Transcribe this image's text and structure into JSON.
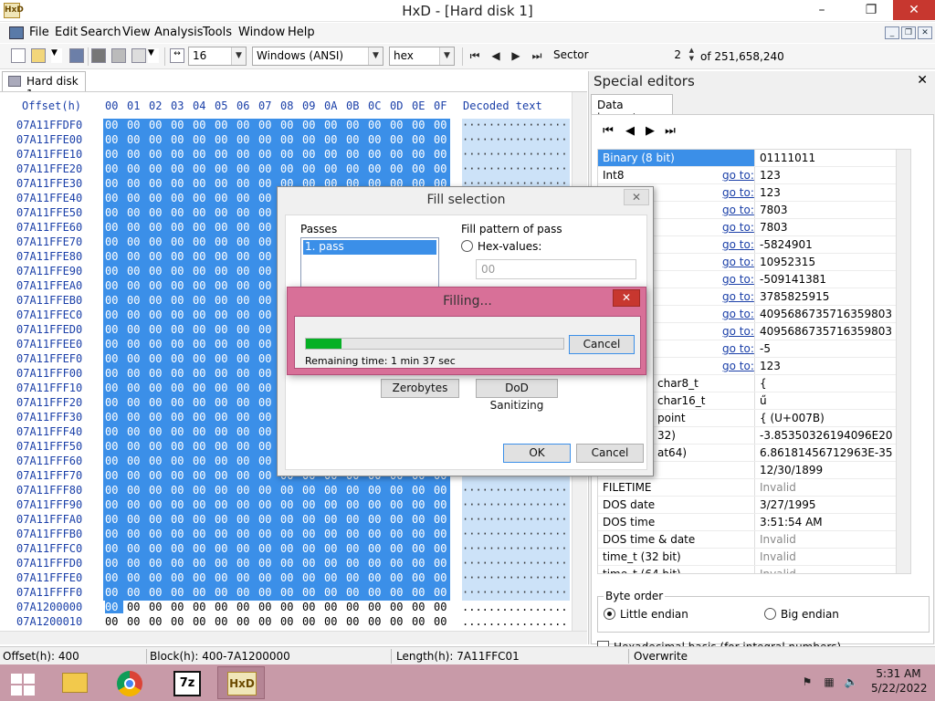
{
  "window": {
    "app_icon_text": "HxD",
    "title": "HxD - [Hard disk 1]",
    "minimize": "–",
    "restore": "❐",
    "close": "✕"
  },
  "menu": {
    "items": [
      "File",
      "Edit",
      "Search",
      "View",
      "Analysis",
      "Tools",
      "Window",
      "Help"
    ],
    "mdi_minimize": "_",
    "mdi_restore": "❐",
    "mdi_close": "✕"
  },
  "toolbar": {
    "bytes_per_row": "16",
    "charset": "Windows (ANSI)",
    "display_mode": "hex",
    "sector_label": "Sector",
    "sector_value": "2",
    "sector_total": "of 251,658,240",
    "icons": [
      "new-file-icon",
      "open-file-icon",
      "save-icon",
      "ram-editor-icon",
      "disk-icon",
      "print-icon",
      "columns-icon"
    ]
  },
  "document_tab": {
    "label": "Hard disk 1"
  },
  "hex_view": {
    "offset_header": "Offset(h)",
    "column_headers": [
      "00",
      "01",
      "02",
      "03",
      "04",
      "05",
      "06",
      "07",
      "08",
      "09",
      "0A",
      "0B",
      "0C",
      "0D",
      "0E",
      "0F"
    ],
    "decoded_header": "Decoded text",
    "byte": "00",
    "selected_dots": "················",
    "plain_dots": "................",
    "rows": [
      "07A11FFDF0",
      "07A11FFE00",
      "07A11FFE10",
      "07A11FFE20",
      "07A11FFE30",
      "07A11FFE40",
      "07A11FFE50",
      "07A11FFE60",
      "07A11FFE70",
      "07A11FFE80",
      "07A11FFE90",
      "07A11FFEA0",
      "07A11FFEB0",
      "07A11FFEC0",
      "07A11FFED0",
      "07A11FFEE0",
      "07A11FFEF0",
      "07A11FFF00",
      "07A11FFF10",
      "07A11FFF20",
      "07A11FFF30",
      "07A11FFF40",
      "07A11FFF50",
      "07A11FFF60",
      "07A11FFF70",
      "07A11FFF80",
      "07A11FFF90",
      "07A11FFFA0",
      "07A11FFFB0",
      "07A11FFFC0",
      "07A11FFFD0",
      "07A11FFFE0",
      "07A11FFFF0",
      "07A1200000",
      "07A1200010"
    ]
  },
  "special_editors": {
    "title": "Special editors",
    "close": "✕",
    "tab": "Data inspector",
    "nav": [
      "⏮",
      "◀",
      "▶",
      "⏭"
    ],
    "goto_label": "go to:",
    "rows": [
      {
        "name": "Binary (8 bit)",
        "value": "01111011",
        "goto": false,
        "selected": true,
        "invalid": false
      },
      {
        "name": "Int8",
        "value": "123",
        "goto": true,
        "selected": false,
        "invalid": false
      },
      {
        "name": "",
        "value": "123",
        "goto": true,
        "selected": false,
        "invalid": false
      },
      {
        "name": "",
        "value": "7803",
        "goto": true,
        "selected": false,
        "invalid": false
      },
      {
        "name": "",
        "value": "7803",
        "goto": true,
        "selected": false,
        "invalid": false
      },
      {
        "name": "",
        "value": "-5824901",
        "goto": true,
        "selected": false,
        "invalid": false
      },
      {
        "name": "",
        "value": "10952315",
        "goto": true,
        "selected": false,
        "invalid": false
      },
      {
        "name": "",
        "value": "-509141381",
        "goto": true,
        "selected": false,
        "invalid": false
      },
      {
        "name": "",
        "value": "3785825915",
        "goto": true,
        "selected": false,
        "invalid": false
      },
      {
        "name": "",
        "value": "4095686735716359803",
        "goto": true,
        "selected": false,
        "invalid": false
      },
      {
        "name": "",
        "value": "4095686735716359803",
        "goto": true,
        "selected": false,
        "invalid": false
      },
      {
        "name": "",
        "value": "-5",
        "goto": true,
        "selected": false,
        "invalid": false
      },
      {
        "name": "",
        "value": "123",
        "goto": true,
        "selected": false,
        "invalid": false
      },
      {
        "name": "char8_t",
        "value": "{",
        "goto": false,
        "selected": false,
        "invalid": false,
        "indent": true
      },
      {
        "name": "char16_t",
        "value": "ű",
        "goto": false,
        "selected": false,
        "invalid": false,
        "indent": true
      },
      {
        "name": "point",
        "value": "{ (U+007B)",
        "goto": false,
        "selected": false,
        "invalid": false,
        "indent": true
      },
      {
        "name": "32)",
        "value": "-3.85350326194096E20",
        "goto": false,
        "selected": false,
        "invalid": false,
        "indent": true
      },
      {
        "name": "at64)",
        "value": "6.86181456712963E-35",
        "goto": false,
        "selected": false,
        "invalid": false,
        "indent": true
      },
      {
        "name": "",
        "value": "12/30/1899",
        "goto": false,
        "selected": false,
        "invalid": false
      },
      {
        "name": "FILETIME",
        "value": "Invalid",
        "goto": false,
        "selected": false,
        "invalid": true
      },
      {
        "name": "DOS date",
        "value": "3/27/1995",
        "goto": false,
        "selected": false,
        "invalid": false
      },
      {
        "name": "DOS time",
        "value": "3:51:54 AM",
        "goto": false,
        "selected": false,
        "invalid": false
      },
      {
        "name": "DOS time & date",
        "value": "Invalid",
        "goto": false,
        "selected": false,
        "invalid": true
      },
      {
        "name": "time_t (32 bit)",
        "value": "Invalid",
        "goto": false,
        "selected": false,
        "invalid": true
      },
      {
        "name": "time_t (64 bit)",
        "value": "Invalid",
        "goto": false,
        "selected": false,
        "invalid": true
      }
    ],
    "byte_order_label": "Byte order",
    "little_endian": "Little endian",
    "big_endian": "Big endian",
    "hex_basis": "Hexadecimal basis (for integral numbers)"
  },
  "status": {
    "offset": "Offset(h): 400",
    "block": "Block(h): 400-7A1200000",
    "length": "Length(h): 7A11FFC01",
    "mode": "Overwrite"
  },
  "fill_dialog": {
    "title": "Fill selection",
    "close": "✕",
    "passes_label": "Passes",
    "pass_item": "1. pass",
    "pattern_label": "Fill pattern of pass",
    "hex_values_label": "Hex-values:",
    "hex_value": "00",
    "zerobytes": "Zerobytes",
    "dod": "DoD Sanitizing",
    "ok": "OK",
    "cancel": "Cancel"
  },
  "filling_dialog": {
    "title": "Filling...",
    "close": "✕",
    "progress": 0.14,
    "remaining": "Remaining time: 1 min 37 sec",
    "cancel": "Cancel"
  },
  "taskbar": {
    "apps": [
      "file-explorer-icon",
      "chrome-icon",
      "7zip-icon",
      "hxd-icon"
    ],
    "app_7z": "7z",
    "app_hxd": "HxD",
    "time": "5:31 AM",
    "date": "5/22/2022"
  },
  "colors": {
    "selection": "#3b8fe8",
    "offset_blue": "#1a3fa8",
    "taskbar": "#c89aa8",
    "filling_frame": "#d87098",
    "progress_green": "#06b025"
  }
}
